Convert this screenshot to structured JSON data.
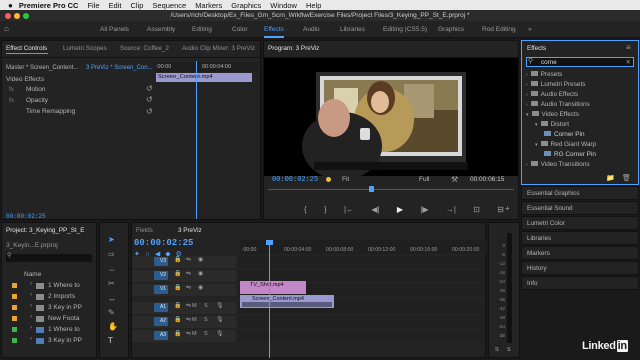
{
  "menubar": {
    "apple": "",
    "app": "Premiere Pro CC",
    "items": [
      "File",
      "Edit",
      "Clip",
      "Sequence",
      "Markers",
      "Graphics",
      "Window",
      "Help"
    ]
  },
  "titlebar": {
    "path": "/Users/rich/Desktop/Ex_Files_Gm_Scrn_Wrkflw/Exercise Files/Project Files/3_Keying_PP_St_E.prproj *"
  },
  "workspaces": [
    "All Panels",
    "Assembly",
    "Editing",
    "Color",
    "Effects",
    "Audio",
    "Libraries",
    "Editing (CS5.5)",
    "Graphics",
    "Rod Editing"
  ],
  "effect_controls": {
    "tabs": [
      "Effect Controls",
      "Lumetri Scopes",
      "Source: Coffee_2",
      "Audio Clip Mixer: 3 PreViz"
    ],
    "master": "Master * Screen_Content...",
    "seq": "3 PreViz * Screen_Con...",
    "ruler_start": ":00:00",
    "ruler_end": "00:00:04:00",
    "clip_name": "Screen_Content.mp4",
    "section": "Video Effects",
    "motion": "Motion",
    "opacity": "Opacity",
    "time_remap": "Time Remapping",
    "timecode": "00:00:02:25",
    "fx": "fx"
  },
  "program": {
    "tab": "Program: 3 PreViz",
    "timecode": "00:00:02:25",
    "fit": "Fit",
    "quality": "Full",
    "duration": "00:00:06:15",
    "transport": [
      "{",
      "}",
      "|←",
      "◀|",
      "▶",
      "|▶",
      "→|",
      "⊡",
      "⊟"
    ]
  },
  "effects": {
    "tab": "Effects",
    "search": "corne",
    "tree": [
      {
        "label": "Presets",
        "level": 0,
        "open": false
      },
      {
        "label": "Lumetri Presets",
        "level": 0,
        "open": false
      },
      {
        "label": "Audio Effects",
        "level": 0,
        "open": false
      },
      {
        "label": "Audio Transitions",
        "level": 0,
        "open": false
      },
      {
        "label": "Video Effects",
        "level": 0,
        "open": true
      },
      {
        "label": "Distort",
        "level": 1,
        "open": true
      },
      {
        "label": "Corner Pin",
        "level": 2
      },
      {
        "label": "Red Giant Warp",
        "level": 1,
        "open": true
      },
      {
        "label": "RG Corner Pin",
        "level": 2
      },
      {
        "label": "Video Transitions",
        "level": 0,
        "open": false
      }
    ]
  },
  "panels_list": [
    "Essential Graphics",
    "Essential Sound",
    "Lumetri Color",
    "Libraries",
    "Markers",
    "History",
    "Info"
  ],
  "project": {
    "tab": "Project: 3_Keying_PP_St_E",
    "file": "3_Keyin...E.prproj",
    "name_header": "Name",
    "items": [
      {
        "label": "1 Where to",
        "color": "#e8a33a",
        "type": "bin"
      },
      {
        "label": "2 Imports",
        "color": "#e8a33a",
        "type": "bin"
      },
      {
        "label": "3 Key in PP",
        "color": "#e8a33a",
        "type": "bin"
      },
      {
        "label": "New Foota",
        "color": "#e8a33a",
        "type": "bin"
      },
      {
        "label": "1 Where to",
        "color": "#3bb54a",
        "type": "seq"
      },
      {
        "label": "3 Key in PP",
        "color": "#3bb54a",
        "type": "seq"
      }
    ]
  },
  "timeline": {
    "tabs": [
      "Fields",
      "3 PreViz"
    ],
    "timecode": "00:00:02:25",
    "ruler": [
      ":00:00",
      "00:00:04:00",
      "00:00:08:00",
      "00:00:12:00",
      "00:00:16:00",
      "00:00:20:00"
    ],
    "tracks": [
      "V3",
      "V2",
      "V1",
      "A1",
      "A2",
      "A3"
    ],
    "clip_v2": "TV_Shot.mp4",
    "clip_v1": "Screen_Content.mp4",
    "m": "M",
    "s": "S"
  },
  "audio_meter": {
    "labels": [
      "0",
      "-6",
      "-12",
      "-18",
      "-24",
      "-30",
      "-36",
      "-42",
      "-48",
      "-54",
      "dB"
    ],
    "s": "S",
    "solo": "S"
  },
  "watermark": "Linked in",
  "colors": {
    "accent": "#4ea1ff",
    "panel": "#232323",
    "bg": "#1a1a1a"
  }
}
